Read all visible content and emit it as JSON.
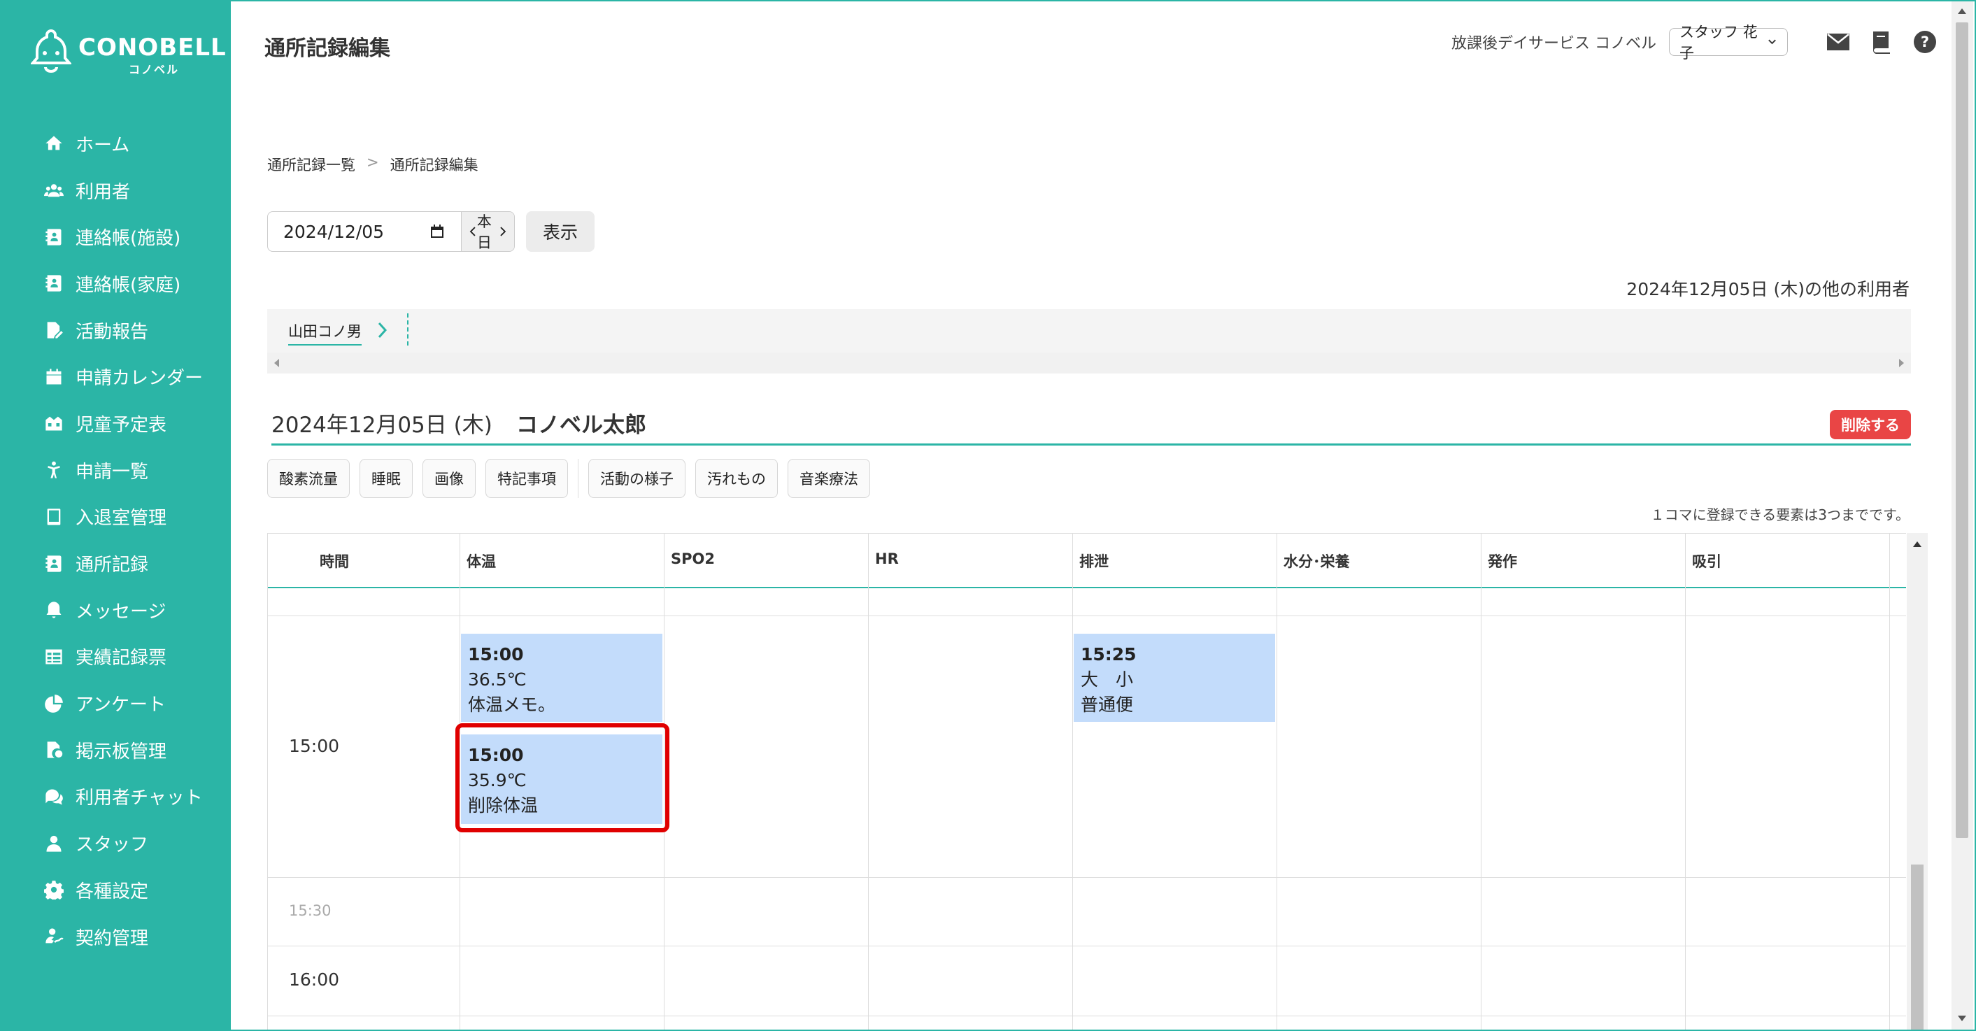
{
  "app": {
    "brand": "CONOBELL",
    "brand_sub": "コノベル"
  },
  "sidebar": {
    "items": [
      {
        "label": "ホーム",
        "icon": "home-icon"
      },
      {
        "label": "利用者",
        "icon": "users-icon"
      },
      {
        "label": "連絡帳(施設)",
        "icon": "contact-book-icon"
      },
      {
        "label": "連絡帳(家庭)",
        "icon": "contact-book-icon"
      },
      {
        "label": "活動報告",
        "icon": "report-icon"
      },
      {
        "label": "申請カレンダー",
        "icon": "calendar-icon"
      },
      {
        "label": "児童予定表",
        "icon": "schedule-icon"
      },
      {
        "label": "申請一覧",
        "icon": "child-icon"
      },
      {
        "label": "入退室管理",
        "icon": "tablet-icon"
      },
      {
        "label": "通所記録",
        "icon": "record-icon"
      },
      {
        "label": "メッセージ",
        "icon": "bell-icon"
      },
      {
        "label": "実績記録票",
        "icon": "table-icon"
      },
      {
        "label": "アンケート",
        "icon": "pie-chart-icon"
      },
      {
        "label": "掲示板管理",
        "icon": "board-icon"
      },
      {
        "label": "利用者チャット",
        "icon": "chat-icon"
      },
      {
        "label": "スタッフ",
        "icon": "staff-icon"
      },
      {
        "label": "各種設定",
        "icon": "gear-icon"
      },
      {
        "label": "契約管理",
        "icon": "contract-icon"
      }
    ]
  },
  "header": {
    "title": "通所記録編集",
    "facility": "放課後デイサービス コノベル",
    "staff": "スタッフ 花子",
    "icons": [
      "mail-icon",
      "book-icon",
      "help-icon"
    ]
  },
  "breadcrumb": {
    "items": [
      "通所記録一覧",
      "通所記録編集"
    ],
    "separator": ">"
  },
  "date_bar": {
    "date": "2024/12/05",
    "today": "本日",
    "show": "表示"
  },
  "other_users": {
    "label": "2024年12月05日 (木)の他の利用者",
    "users": [
      "山田コノ男"
    ]
  },
  "record": {
    "date": "2024年12月05日 (木)",
    "name": "コノベル太郎",
    "delete": "削除する"
  },
  "chips": [
    "酸素流量",
    "睡眠",
    "画像",
    "特記事項",
    "活動の様子",
    "汚れもの",
    "音楽療法"
  ],
  "limit_note": "１コマに登録できる要素は3つまでです。",
  "grid": {
    "columns": [
      "時間",
      "体温",
      "SPO2",
      "HR",
      "排泄",
      "水分･栄養",
      "発作",
      "吸引"
    ],
    "times": [
      "15:00",
      "15:30",
      "16:00"
    ],
    "cards": [
      {
        "column": "体温",
        "time": "15:00",
        "value": "36.5℃",
        "memo": "体温メモ。"
      },
      {
        "column": "体温",
        "time": "15:00",
        "value": "35.9℃",
        "memo": "削除体温"
      },
      {
        "column": "排泄",
        "time": "15:25",
        "value": "大　小",
        "memo": "普通便"
      }
    ]
  },
  "colors": {
    "accent": "#2bb5a6",
    "card": "#c3dcfb",
    "danger": "#e94545",
    "highlight": "#e00000"
  }
}
